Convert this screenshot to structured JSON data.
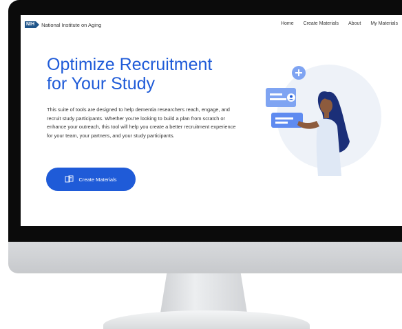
{
  "site": {
    "logo_badge": "NIH",
    "logo_text": "National Institute on Aging"
  },
  "nav": {
    "links": [
      "Home",
      "Create Materials",
      "About",
      "My Materials"
    ]
  },
  "hero": {
    "title_line1": "Optimize Recruitment",
    "title_line2": "for Your Study",
    "description": "This suite of tools are designed to help dementia researchers reach, engage, and recruit study participants. Whether you're looking to build a plan from scratch or enhance your outreach, this tool will help you create a better recruitment experience for your team, your partners, and your study participants.",
    "cta_label": "Create Materials",
    "cta_icon": "documents-icon"
  },
  "colors": {
    "accent": "#1f5bd8",
    "nih_blue": "#20558a",
    "bezel": "#0b0b0b"
  }
}
